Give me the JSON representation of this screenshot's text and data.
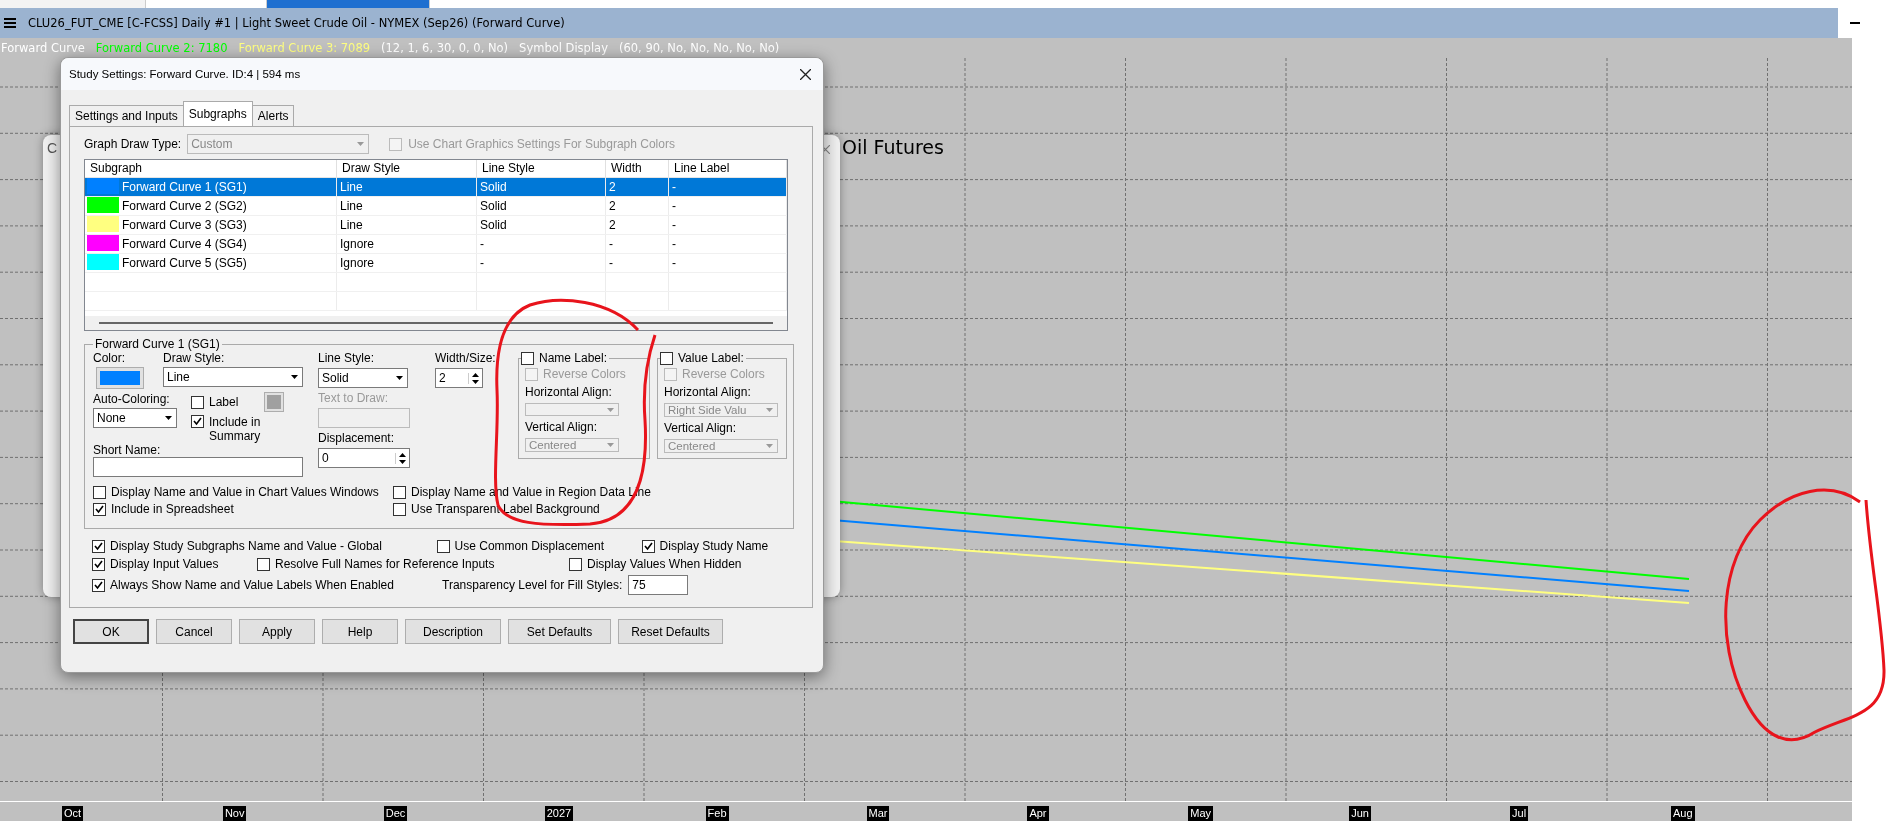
{
  "window": {
    "title": "CLU26_FUT_CME [C-FCSS]  Daily #1 | Light Sweet Crude Oil - NYMEX (Sep26) (Forward Curve)"
  },
  "study_line": [
    {
      "text": "Forward Curve",
      "color": "#ffffff"
    },
    {
      "text": "Forward Curve 2: 7180",
      "color": "#00ff00"
    },
    {
      "text": "Forward Curve 3: 7089",
      "color": "#ffff80"
    },
    {
      "text": "(12, 1, 6, 30, 0, 0, No)",
      "color": "#ffffff"
    },
    {
      "text": "Symbol Display",
      "color": "#ffffff"
    },
    {
      "text": "(60, 90, No, No, No, No, No)",
      "color": "#ffffff"
    }
  ],
  "chart": {
    "title": "Oil Futures",
    "x_labels": [
      "Oct",
      "Nov",
      "Dec",
      "2027",
      "Feb",
      "Mar",
      "Apr",
      "May",
      "Jun",
      "Jul",
      "Aug"
    ]
  },
  "background_dialog": {
    "title": "C"
  },
  "dialog": {
    "title": "Study Settings: Forward Curve. ID:4 | 594 ms",
    "tabs": [
      {
        "label": "Settings and Inputs",
        "selected": false
      },
      {
        "label": "Subgraphs",
        "selected": true
      },
      {
        "label": "Alerts",
        "selected": false
      }
    ],
    "graph_draw_type": {
      "label": "Graph Draw Type:",
      "value": "Custom",
      "disabled": true
    },
    "use_chart_graphics": {
      "label": "Use Chart Graphics Settings For Subgraph Colors",
      "checked": false,
      "disabled": true
    },
    "table": {
      "columns": [
        "Subgraph",
        "Draw Style",
        "Line Style",
        "Width",
        "Line Label"
      ],
      "rows": [
        {
          "color": "#0080ff",
          "cells": [
            "Forward Curve 1 (SG1)",
            "Line",
            "Solid",
            "2",
            "-"
          ],
          "selected": true
        },
        {
          "color": "#00ff00",
          "cells": [
            "Forward Curve 2 (SG2)",
            "Line",
            "Solid",
            "2",
            "-"
          ],
          "selected": false
        },
        {
          "color": "#ffff80",
          "cells": [
            "Forward Curve 3 (SG3)",
            "Line",
            "Solid",
            "2",
            "-"
          ],
          "selected": false
        },
        {
          "color": "#ff00ff",
          "cells": [
            "Forward Curve 4 (SG4)",
            "Ignore",
            "-",
            "-",
            "-"
          ],
          "selected": false
        },
        {
          "color": "#00ffff",
          "cells": [
            "Forward Curve 5 (SG5)",
            "Ignore",
            "-",
            "-",
            "-"
          ],
          "selected": false
        }
      ]
    },
    "group": {
      "title": "Forward Curve 1 (SG1)",
      "color_label": "Color:",
      "color": "#0080ff",
      "draw_style": {
        "label": "Draw Style:",
        "value": "Line"
      },
      "auto_coloring": {
        "label": "Auto-Coloring:",
        "value": "None"
      },
      "label_check": {
        "label": "Label",
        "checked": false
      },
      "include_summary": {
        "label": "Include in Summary",
        "checked": true
      },
      "short_name": {
        "label": "Short Name:"
      },
      "line_style": {
        "label": "Line Style:",
        "value": "Solid"
      },
      "text_to_draw": {
        "label": "Text to Draw:",
        "disabled": true
      },
      "displacement": {
        "label": "Displacement:",
        "value": "0"
      },
      "width_size": {
        "label": "Width/Size:",
        "value": "2"
      },
      "label_boxes": [
        {
          "label": "Name Label:",
          "checked": false,
          "reverse": {
            "label": "Reverse Colors",
            "checked": false,
            "disabled": true
          },
          "h_label": "Horizontal Align:",
          "v_label": "Vertical Align:",
          "v_value": "Centered",
          "disabled": true
        },
        {
          "label": "Value Label:",
          "checked": false,
          "reverse": {
            "label": "Reverse Colors",
            "checked": false,
            "disabled": true
          },
          "h_label": "Horizontal Align:",
          "h_value": "Right Side Valu",
          "v_label": "Vertical Align:",
          "v_value": "Centered",
          "disabled": true
        }
      ],
      "options": [
        {
          "label": "Display Name and Value in Chart Values Windows",
          "checked": false
        },
        {
          "label": "Display Name and Value in Region Data Line",
          "checked": false
        },
        {
          "label": "Include in Spreadsheet",
          "checked": true
        },
        {
          "label": "Use Transparent Label Background",
          "checked": false
        }
      ]
    },
    "global_rows": [
      [
        {
          "label": "Display Study Subgraphs Name and Value - Global",
          "checked": true
        },
        {
          "label": "Use Common Displacement",
          "checked": false
        },
        {
          "label": "Display Study Name",
          "checked": true
        }
      ],
      [
        {
          "label": "Display Input Values",
          "checked": true
        },
        {
          "label": "Resolve Full Names for Reference Inputs",
          "checked": false
        },
        {
          "label": "Display Values When Hidden",
          "checked": false
        }
      ],
      [
        {
          "label": "Always Show Name and Value Labels When Enabled",
          "checked": true
        }
      ]
    ],
    "transparency": {
      "label": "Transparency Level for Fill Styles:",
      "value": "75"
    },
    "buttons": [
      "OK",
      "Cancel",
      "Apply",
      "Help",
      "Description",
      "Set Defaults",
      "Reset Defaults"
    ]
  }
}
